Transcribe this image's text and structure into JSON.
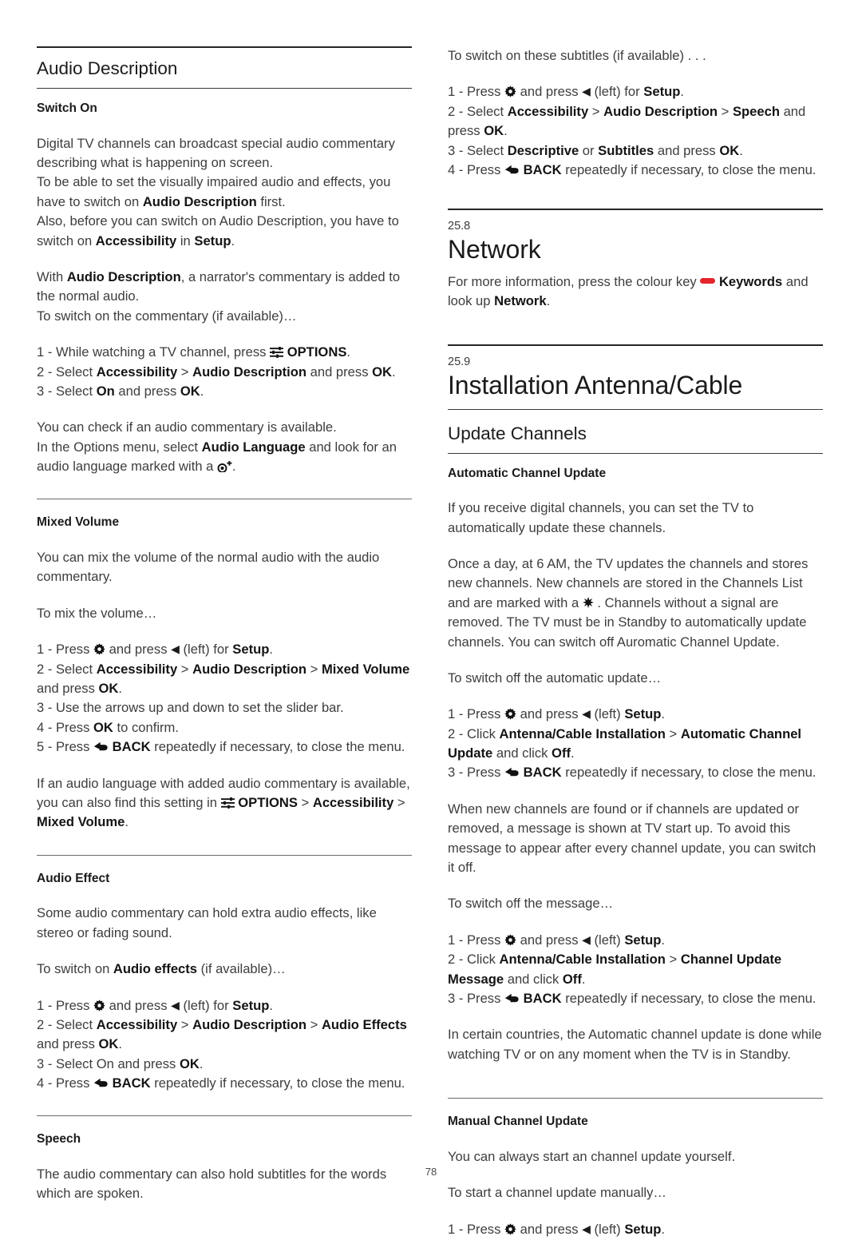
{
  "page": {
    "number": "78",
    "colour_key_hex": "#e5242c",
    "text_hex": "#3d3d3d",
    "heading_hex": "#1b1b1b"
  },
  "icons": {
    "gear": "gear-icon",
    "options": "options-sliders-icon",
    "back": "back-arrow-icon",
    "star": "star-icon",
    "audio_description_marker": "eye-plus-icon",
    "arrow_left": "◀",
    "colour_key": "red-colour-key-icon"
  },
  "left_column": {
    "section_title": "Audio Description",
    "blocks": [
      {
        "id": "switch-on",
        "sub_head": "Switch On",
        "paragraphs": [
          "Digital TV channels can broadcast special audio commentary describing what is happening on screen.",
          "To be able to set the visually impaired audio and effects, you have to switch on Audio Description first.",
          "Also, before you can switch on Audio Description, you have to switch on Accessibility in Setup.",
          "With Audio Description, a narrator's commentary is added to the normal audio.",
          "To switch on the commentary (if available)…"
        ],
        "steps": [
          "1 - While watching a TV channel, press ☰ OPTIONS.",
          "2 - Select Accessibility > Audio Description and press OK.",
          "3 - Select On and press OK."
        ],
        "after": [
          "You can check if an audio commentary is available.",
          "In the Options menu, select Audio Language and look for an audio language marked with a ⊙+."
        ]
      },
      {
        "id": "mixed-volume",
        "sub_head": "Mixed Volume",
        "paragraphs": [
          "You can mix the volume of the normal audio with the audio commentary.",
          "To mix the volume…"
        ],
        "steps": [
          "1 - Press ⚙ and press ◀ (left) for Setup.",
          "2 - Select Accessibility > Audio Description > Mixed Volume and press OK.",
          "3 - Use the arrows up and down to set the slider bar.",
          "4 - Press OK to confirm.",
          "5 - Press ⏎ BACK repeatedly if necessary, to close the menu."
        ],
        "after": [
          "If an audio language with added audio commentary is available, you can also find this setting in ☰ OPTIONS > Accessibility > Mixed Volume."
        ]
      },
      {
        "id": "audio-effect",
        "sub_head": "Audio Effect",
        "paragraphs": [
          "Some audio commentary can hold extra audio effects, like stereo or fading sound.",
          "To switch on Audio effects (if available)…"
        ],
        "steps": [
          "1 - Press ⚙ and press ◀ (left) for Setup.",
          "2 - Select Accessibility > Audio Description > Audio Effects and press OK.",
          "3 - Select On and press OK.",
          "4 - Press ⏎ BACK repeatedly if necessary, to close the menu."
        ],
        "after": []
      },
      {
        "id": "speech",
        "sub_head": "Speech",
        "paragraphs": [
          "The audio commentary can also hold subtitles for the words which are spoken."
        ],
        "steps": [],
        "after": []
      }
    ]
  },
  "right_column": {
    "speech_continued": {
      "lead": "To switch on these subtitles (if available) . . .",
      "steps": [
        "1 - Press ⚙ and press ◀ (left) for Setup.",
        "2 - Select Accessibility > Audio Description > Speech and press OK.",
        "3 - Select Descriptive or Subtitles and press OK.",
        "4 - Press ⏎ BACK repeatedly if necessary, to close the menu."
      ]
    },
    "network": {
      "chapter_num": "25.8",
      "title": "Network",
      "paragraph": "For more information, press the colour key ▬ Keywords and look up Network."
    },
    "installation": {
      "chapter_num": "25.9",
      "title": "Installation Antenna/Cable",
      "section_title": "Update Channels",
      "blocks": [
        {
          "id": "automatic-channel-update",
          "sub_head": "Automatic Channel Update",
          "paragraphs": [
            "If you receive digital channels, you can set the TV to automatically update these channels.",
            "Once a day, at 6 AM, the TV updates the channels and stores new channels. New channels are stored in the Channels List and are marked with a ✱ . Channels without a signal are removed. The TV must be in Standby to automatically update channels. You can switch off Auromatic Channel Update.",
            "To switch off the automatic update…"
          ],
          "steps_1": [
            "1 - Press ⚙ and press ◀ (left) Setup.",
            "2 - Click Antenna/Cable Installation > Automatic Channel Update and click Off.",
            "3 - Press ⏎ BACK repeatedly if necessary, to close the menu."
          ],
          "paragraphs_2": [
            "When new channels are found or if channels are updated or removed, a message is shown at TV start up. To avoid this message to appear after every channel update, you can switch it off.",
            "To switch off the message…"
          ],
          "steps_2": [
            "1 - Press ⚙ and press ◀ (left) Setup.",
            "2 - Click Antenna/Cable Installation > Channel Update Message and click Off.",
            "3 - Press ⏎ BACK repeatedly if necessary, to close the menu."
          ],
          "paragraphs_3": [
            "In certain countries, the Automatic channel update is done while watching TV or on any moment when the TV is in Standby."
          ]
        },
        {
          "id": "manual-channel-update",
          "sub_head": "Manual Channel Update",
          "paragraphs": [
            "You can always start an channel update yourself.",
            "To start a channel update manually…"
          ],
          "steps_1": [
            "1 - Press ⚙ and press ◀ (left) Setup."
          ]
        }
      ]
    }
  }
}
